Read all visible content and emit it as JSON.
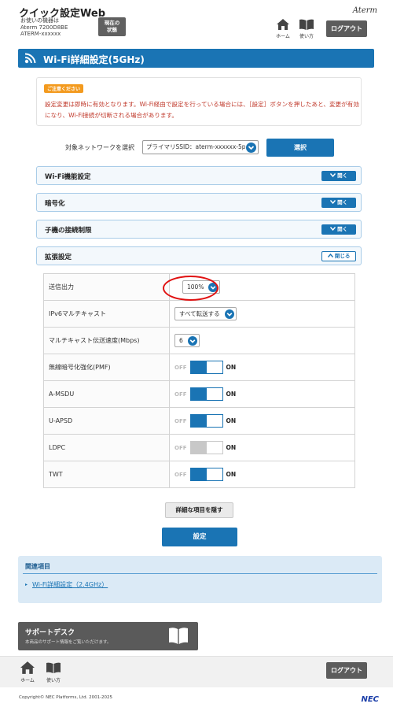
{
  "header": {
    "app_title": "クイック設定Web",
    "device_line1": "お使いの機器は",
    "device_line2": "Aterm 7200D8BE",
    "device_line3": "ATERM-xxxxxx",
    "status_line1": "現在の",
    "status_line2": "状態",
    "home_label": "ホーム",
    "howto_label": "使い方",
    "logout_label": "ログアウト",
    "brand": "Aterm"
  },
  "page": {
    "title": "Wi-Fi詳細設定(5GHz)"
  },
  "notice": {
    "badge": "ご注意ください",
    "text": "設定変更は即時に有効となります。Wi-Fi経由で設定を行っている場合には、［設定］ボタンを押したあと、変更が有効になり、Wi-Fi接続が切断される場合があります。"
  },
  "target_network": {
    "label": "対象ネットワークを選択",
    "value": "プライマリSSID：aterm-xxxxxx-5p",
    "select_button": "選択"
  },
  "sections": {
    "wifi_function": {
      "title": "Wi-Fi機能設定",
      "button": "開く"
    },
    "encryption": {
      "title": "暗号化",
      "button": "開く"
    },
    "client_limit": {
      "title": "子機の接続制限",
      "button": "開く"
    },
    "extended": {
      "title": "拡張設定",
      "button": "閉じる"
    }
  },
  "extended_settings": {
    "tx_power": {
      "label": "送信出力",
      "value": "100%"
    },
    "ipv6_multicast": {
      "label": "IPv6マルチキャスト",
      "value": "すべて転送する"
    },
    "multicast_rate": {
      "label": "マルチキャスト伝送速度(Mbps)",
      "value": "6"
    },
    "pmf": {
      "label": "無線暗号化強化(PMF)",
      "off": "OFF",
      "on": "ON",
      "state": true
    },
    "amsdu": {
      "label": "A-MSDU",
      "off": "OFF",
      "on": "ON",
      "state": true
    },
    "uapsd": {
      "label": "U-APSD",
      "off": "OFF",
      "on": "ON",
      "state": true
    },
    "ldpc": {
      "label": "LDPC",
      "off": "OFF",
      "on": "ON",
      "state": true,
      "disabled": true
    },
    "twt": {
      "label": "TWT",
      "off": "OFF",
      "on": "ON",
      "state": true
    }
  },
  "actions": {
    "hide_details": "詳細な項目を隠す",
    "apply": "設定"
  },
  "related": {
    "title": "関連項目",
    "link": "Wi-Fi詳細設定（2.4GHz）"
  },
  "support": {
    "title": "サポートデスク",
    "subtitle": "本商品のサポート情報をご覧いただけます。"
  },
  "footer": {
    "home_label": "ホーム",
    "howto_label": "使い方",
    "logout_label": "ログアウト",
    "copyright": "Copyright© NEC Platforms, Ltd. 2001-2025",
    "vendor": "NEC"
  },
  "colors": {
    "primary": "#1a74b4",
    "warning": "#c0392b",
    "badge": "#f39a1e",
    "highlight_ring": "#e01010"
  },
  "icons": [
    "wifi-icon",
    "home-icon",
    "book-icon",
    "chevron-down-icon",
    "chevron-up-icon"
  ]
}
